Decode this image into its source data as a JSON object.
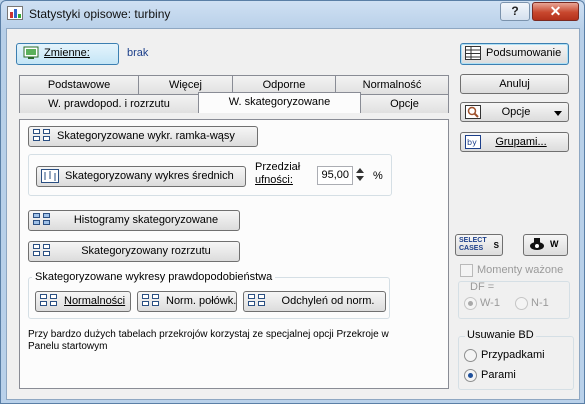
{
  "window": {
    "title": "Statystyki opisowe: turbiny",
    "help_label": "?",
    "close_label": "✕"
  },
  "variables": {
    "button_label": "Zmienne:",
    "value": "brak"
  },
  "tabs": {
    "row_top": [
      "Podstawowe",
      "Więcej",
      "Odporne",
      "Normalność"
    ],
    "row_bottom": [
      "W. prawdopod. i rozrzutu",
      "W. skategoryzowane",
      "Opcje"
    ],
    "active": "W. skategoryzowane"
  },
  "panel": {
    "boxplot_label": "Skategoryzowane wykr. ramka-wąsy",
    "means_plot_label": "Skategoryzowany wykres średnich",
    "interval_label_line1": "Przedział",
    "interval_label_line2": "ufności:",
    "interval_value": "95,00",
    "interval_unit": "%",
    "histograms_label": "Histogramy skategoryzowane",
    "scatter_label": "Skategoryzowany rozrzutu",
    "prob_group_label": "Skategoryzowane wykresy prawdopodobieństwa",
    "normal_label": "Normalności",
    "halfnormal_label": "Norm. połówk.",
    "detrended_label": "Odchyleń od norm.",
    "note": "Przy bardzo dużych tabelach przekrojów korzystaj ze specjalnej opcji Przekroje w Panelu startowym"
  },
  "right": {
    "summary_label": "Podsumowanie",
    "cancel_label": "Anuluj",
    "options_label": "Opcje",
    "groups_label": "Grupami...",
    "select_cases_line1": "SELECT",
    "select_cases_line2": "CASES",
    "select_cases_s": "S",
    "weight_w": "W",
    "moments_weighted_label": "Momenty ważone",
    "df_label": "DF =",
    "df_options": [
      "W-1",
      "N-1"
    ],
    "df_selected": "W-1",
    "missing_label": "Usuwanie BD",
    "missing_options": [
      "Przypadkami",
      "Parami"
    ],
    "missing_selected": "Parami"
  },
  "colors": {
    "accent_blue": "#3c7fb1",
    "close_red": "#c8472e",
    "icon_blue": "#9fc1e8"
  }
}
